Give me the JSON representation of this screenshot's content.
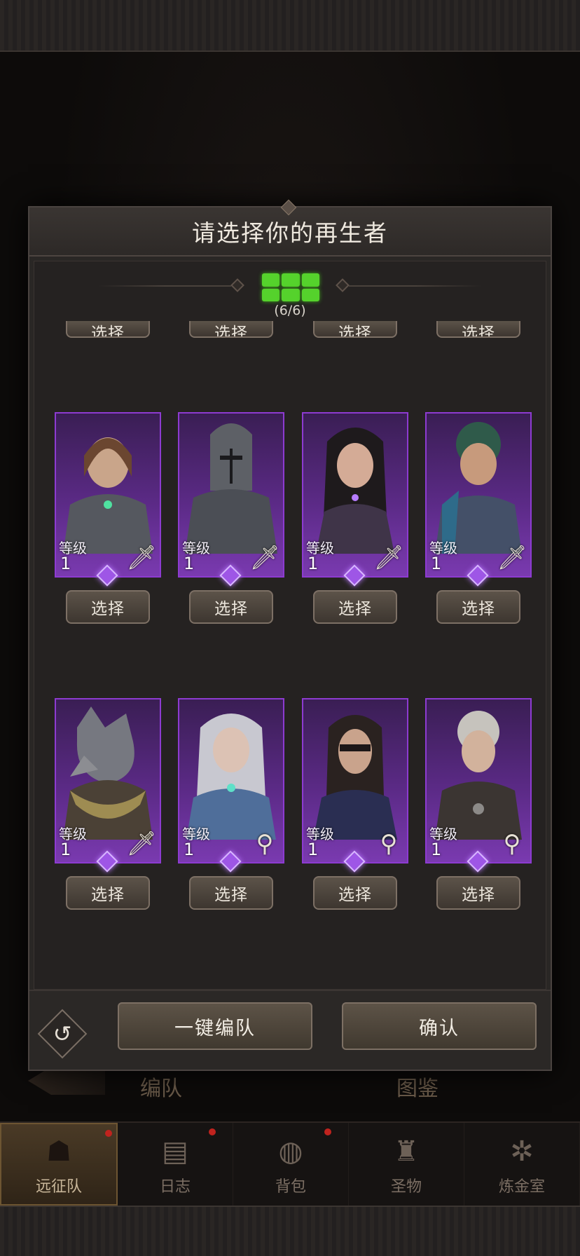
{
  "modal": {
    "title": "请选择你的再生者",
    "team_count": "(6/6)",
    "select_label": "选择",
    "level_label": "等级",
    "auto_team_label": "一键编队",
    "confirm_label": "确认"
  },
  "background_tabs": [
    "编队",
    "图鉴"
  ],
  "heroes_row1": [
    {
      "level": "1",
      "class_icon": "sword-icon"
    },
    {
      "level": "1",
      "class_icon": "sword-icon"
    },
    {
      "level": "1",
      "class_icon": "sword-icon"
    },
    {
      "level": "1",
      "class_icon": "sword-icon"
    }
  ],
  "heroes_row2": [
    {
      "level": "1",
      "class_icon": "sword-icon"
    },
    {
      "level": "1",
      "class_icon": "staff-icon"
    },
    {
      "level": "1",
      "class_icon": "staff-icon"
    },
    {
      "level": "1",
      "class_icon": "staff-icon"
    }
  ],
  "bottom_nav": [
    {
      "label": "远征队",
      "icon": "horned-helmet-icon",
      "active": true,
      "badge": true
    },
    {
      "label": "日志",
      "icon": "scroll-icon",
      "active": false,
      "badge": true
    },
    {
      "label": "背包",
      "icon": "bag-icon",
      "active": false,
      "badge": true
    },
    {
      "label": "圣物",
      "icon": "relic-icon",
      "active": false,
      "badge": false
    },
    {
      "label": "炼金室",
      "icon": "alchemy-icon",
      "active": false,
      "badge": false
    }
  ],
  "colors": {
    "team_slot_green": "#55d22c",
    "card_purple": "#8d3bd1",
    "badge_red": "#c0231e"
  }
}
